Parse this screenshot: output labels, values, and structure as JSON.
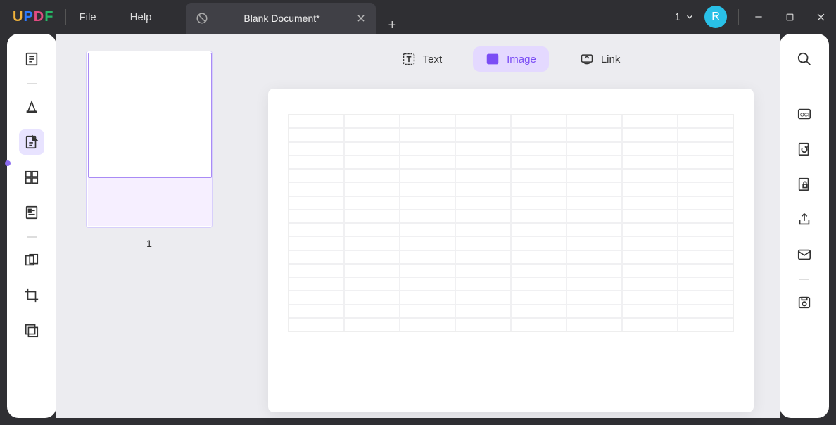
{
  "app": {
    "logo": [
      "U",
      "P",
      "D",
      "F"
    ]
  },
  "menus": {
    "file": "File",
    "help": "Help"
  },
  "tab": {
    "title": "Blank Document*"
  },
  "page_indicator": {
    "current": "1"
  },
  "avatar": {
    "initial": "R"
  },
  "tools": {
    "text": "Text",
    "image": "Image",
    "link": "Link",
    "active": "image"
  },
  "thumbnail": {
    "page_number": "1"
  },
  "left_sidebar": {
    "items": [
      "reader",
      "comment",
      "edit",
      "page",
      "form",
      "crop",
      "redact"
    ],
    "active_index": 2
  },
  "right_sidebar": {
    "items": [
      "search",
      "ocr",
      "convert",
      "protect",
      "share",
      "mail",
      "save"
    ]
  },
  "grid": {
    "rows": 16,
    "cols": 8
  }
}
